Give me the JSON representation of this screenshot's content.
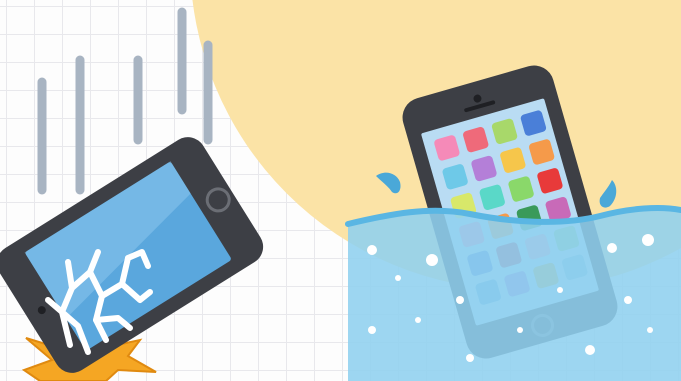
{
  "scene": {
    "description_visible_text": "",
    "colors": {
      "sun_backdrop": "#fbe3a6",
      "grid_line": "#e8e8ec",
      "phone_body": "#3d3f45",
      "phone_screen": "#5aa7dd",
      "crack": "#ffffff",
      "impact_burst": "#f5a623",
      "motion_lines": "#a8b4c2",
      "water": "#8fd0ef",
      "water_dark": "#5ab6e3",
      "water_droplet": "#4aa8d8"
    },
    "icons": {
      "left": "dropped-phone-cracked-screen",
      "right": "phone-submerged-in-water"
    }
  }
}
